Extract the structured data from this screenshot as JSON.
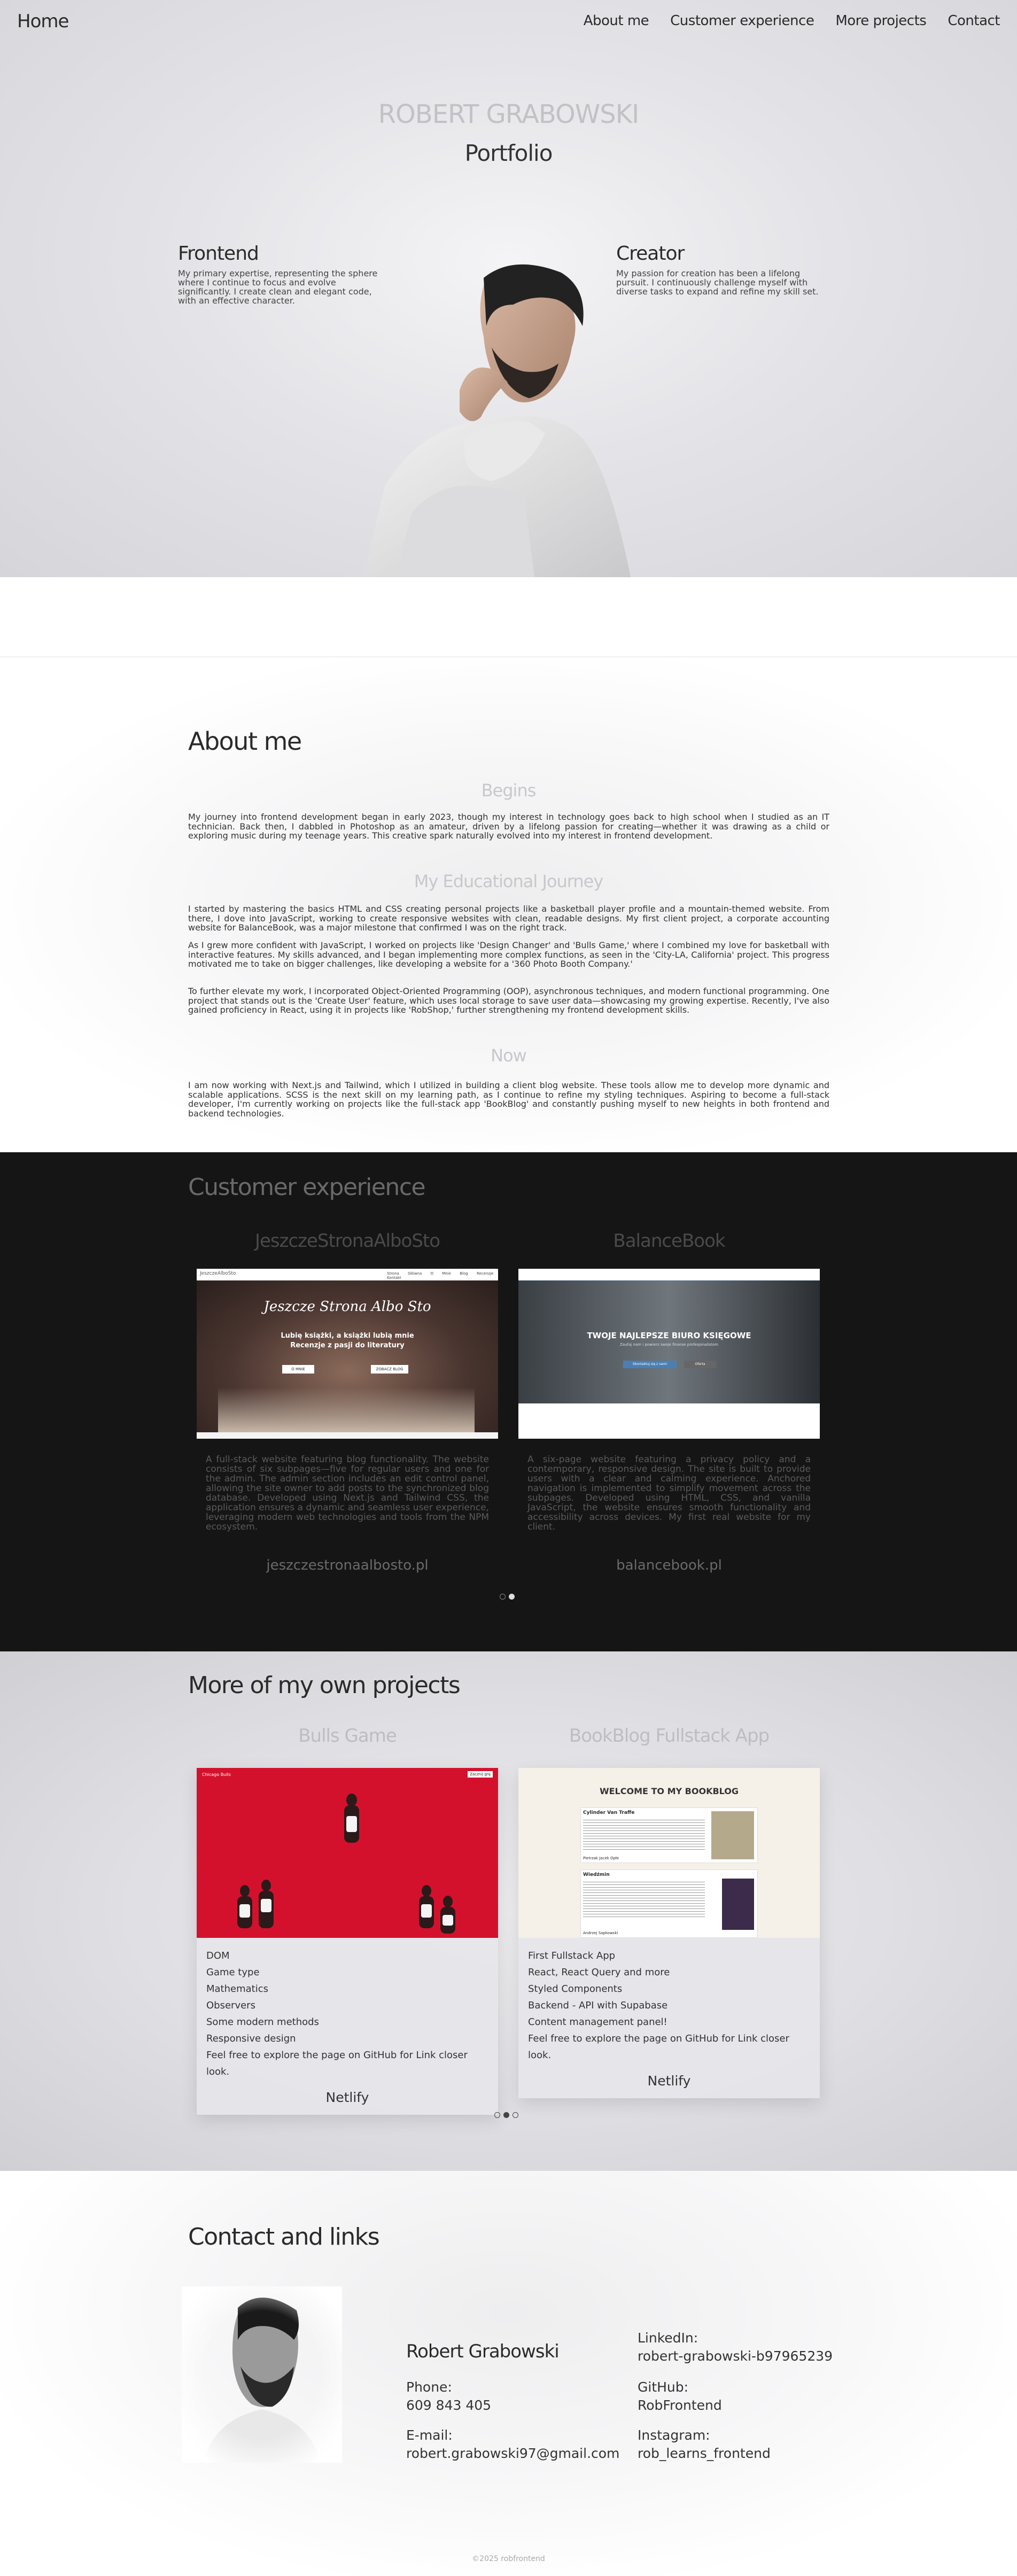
{
  "nav": {
    "home": "Home",
    "links": [
      "About me",
      "Customer experience",
      "More projects",
      "Contact"
    ]
  },
  "hero": {
    "name": "ROBERT GRABOWSKI",
    "subtitle": "Portfolio",
    "left_title": "Frontend",
    "left_text": "My primary expertise, representing the sphere where I continue to focus and evolve significantly. I create clean and elegant code, with an effective character.",
    "right_title": "Creator",
    "right_text": "My passion for creation has been a lifelong pursuit. I continuously challenge myself with diverse tasks to expand and refine my skill set."
  },
  "about": {
    "title": "About me",
    "h_begins": "Begins",
    "p_begins": "My journey into frontend development began in early 2023, though my interest in technology goes back to high school when I studied as an IT technician. Back then, I dabbled in Photoshop as an amateur, driven by a lifelong passion for creating—whether it was drawing as a child or exploring music during my teenage years. This creative spark naturally evolved into my interest in frontend development.",
    "h_edu": "My Educational Journey",
    "p_edu1": "I started by mastering the basics HTML and CSS creating personal projects like a basketball player profile and a mountain-themed website. From there, I dove into JavaScript, working to create responsive websites with clean, readable designs. My first client project, a corporate accounting website for BalanceBook, was a major milestone that confirmed I was on the right track.",
    "p_edu2": "As I grew more confident with JavaScript, I worked on projects like 'Design Changer' and 'Bulls Game,' where I combined my love for basketball with interactive features. My skills advanced, and I began implementing more complex functions, as seen in the 'City-LA, California' project. This progress motivated me to take on bigger challenges, like developing a website for a '360 Photo Booth Company.'",
    "p_edu3": "To further elevate my work, I incorporated Object-Oriented Programming (OOP), asynchronous techniques, and modern functional programming. One project that stands out is the 'Create User' feature, which uses local storage to save user data—showcasing my growing expertise. Recently, I've also gained proficiency in React, using it in projects like 'RobShop,' further strengthening my frontend development skills.",
    "h_now": "Now",
    "p_now": "I am now working with Next.js and Tailwind, which I utilized in building a client blog website. These tools allow me to develop more dynamic and scalable applications. SCSS is the next skill on my learning path, as I continue to refine my styling techniques. Aspiring to become a full-stack developer, I'm currently working on projects like the full-stack app 'BookBlog' and constantly pushing myself to new heights in both frontend and backend technologies."
  },
  "customer": {
    "title": "Customer experience",
    "cards": [
      {
        "title": "JeszczeStronaAlboSto",
        "desc": "A full-stack website featuring blog functionality. The website consists of six subpages—five for regular users and one for the admin. The admin section includes an edit control panel, allowing the site owner to add posts to the synchronized blog database. Developed using Next.js and Tailwind CSS, the application ensures a dynamic and seamless user experience, leveraging modern web technologies and tools from the NPM ecosystem.",
        "link": "jeszczestronaalbosto.pl",
        "shot_logo": "JeszczeAlboSto",
        "shot_headline": "Jeszcze Strona Albo Sto",
        "shot_sub1": "Lubię książki, a książki lubią mnie",
        "shot_sub2": "Recenzje z pasji do literatury",
        "shot_btn1": "O MNIE",
        "shot_btn2": "ZOBACZ BLOG",
        "shot_menu": [
          "Strona Główna",
          "O Mnie",
          "Blog",
          "Recenzje",
          "Kontakt"
        ]
      },
      {
        "title": "BalanceBook",
        "desc": "A six-page website featuring a privacy policy and a contemporary, responsive design. The site is built to provide users with a clear and calming experience. Anchored navigation is implemented to simplify movement across the subpages. Developed using HTML, CSS, and vanilla JavaScript, the website ensures smooth functionality and accessibility across devices. My first real website for my client.",
        "link": "balancebook.pl",
        "shot_headline": "TWOJE NAJLEPSZE BIURO KSIĘGOWE",
        "shot_sub": "Zaufaj nam i powierz swoje finanse profesjonalistom",
        "shot_btn1": "Skontaktuj się z nami",
        "shot_btn2": "Oferta"
      }
    ]
  },
  "projects": {
    "title": "More of my own projects",
    "cards": [
      {
        "title": "Bulls Game",
        "items": [
          "DOM",
          "Game type",
          "Mathematics",
          "Observers",
          "Some modern methods",
          "Responsive design",
          "Feel free to explore the page on GitHub for Link closer look."
        ],
        "link": "Netlify",
        "shot_logo": "Chicago Bulls",
        "shot_btn": "Zacznij grę"
      },
      {
        "title": "BookBlog Fullstack App",
        "items": [
          "First Fullstack App",
          "React, React Query and more",
          "Styled Components",
          "Backend - API with Supabase",
          "Content management panel!",
          "Feel free to explore the page on GitHub for Link closer look."
        ],
        "link": "Netlify",
        "shot_header": "WELCOME TO MY BOOKBLOG",
        "shot_book1": "Cylinder Van Traffe",
        "shot_book2": "Wiedźmin",
        "shot_author1": "Pietrzak Jacek Opłe",
        "shot_author2": "Andrzej Sapkowski"
      }
    ]
  },
  "contact": {
    "title": "Contact and links",
    "name": "Robert Grabowski",
    "phone_label": "Phone:",
    "phone": "609 843 405",
    "email_label": "E-mail:",
    "email": "robert.grabowski97@gmail.com",
    "linkedin_label": "LinkedIn:",
    "linkedin": "robert-grabowski-b97965239",
    "github_label": "GitHub:",
    "github": "RobFrontend",
    "instagram_label": "Instagram:",
    "instagram": "rob_learns_frontend",
    "footer": "©2025 robfrontend"
  },
  "colors": {
    "dark_section": "#151515",
    "bulls_red": "#d4112d",
    "text_dark": "#2a2a2a",
    "text_faded": "#c2c2c6"
  }
}
